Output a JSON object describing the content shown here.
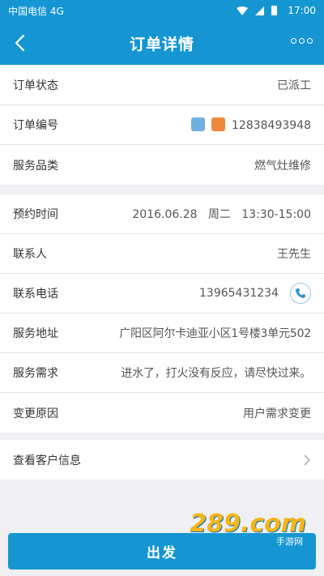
{
  "status_bar": {
    "carrier": "中国电信 4G",
    "time": "17:00"
  },
  "nav": {
    "title": "订单详情",
    "back_icon": "back-arrow-icon",
    "more_icon": "more-dots-icon"
  },
  "order": {
    "status_label": "订单状态",
    "status_value": "已派工",
    "number_label": "订单编号",
    "number_value": "12838493948",
    "category_label": "服务品类",
    "category_value": "燃气灶维修"
  },
  "service": {
    "appointment_label": "预约时间",
    "appointment_value": "2016.06.28   周二   13:30-15:00",
    "contact_label": "联系人",
    "contact_value": "王先生",
    "phone_label": "联系电话",
    "phone_value": "13965431234",
    "address_label": "服务地址",
    "address_value": "广阳区阿尔卡迪亚小区1号楼3单元502",
    "demand_label": "服务需求",
    "demand_value": "进水了，打火没有反应，请尽快过来。",
    "change_label": "变更原因",
    "change_value": "用户需求变更"
  },
  "customer_link": {
    "label": "查看客户信息"
  },
  "action": {
    "depart_label": "出发"
  },
  "watermark": {
    "logo": "289.com",
    "text": "手游网"
  },
  "colors": {
    "primary": "#1596d3",
    "background": "#efeff4"
  }
}
